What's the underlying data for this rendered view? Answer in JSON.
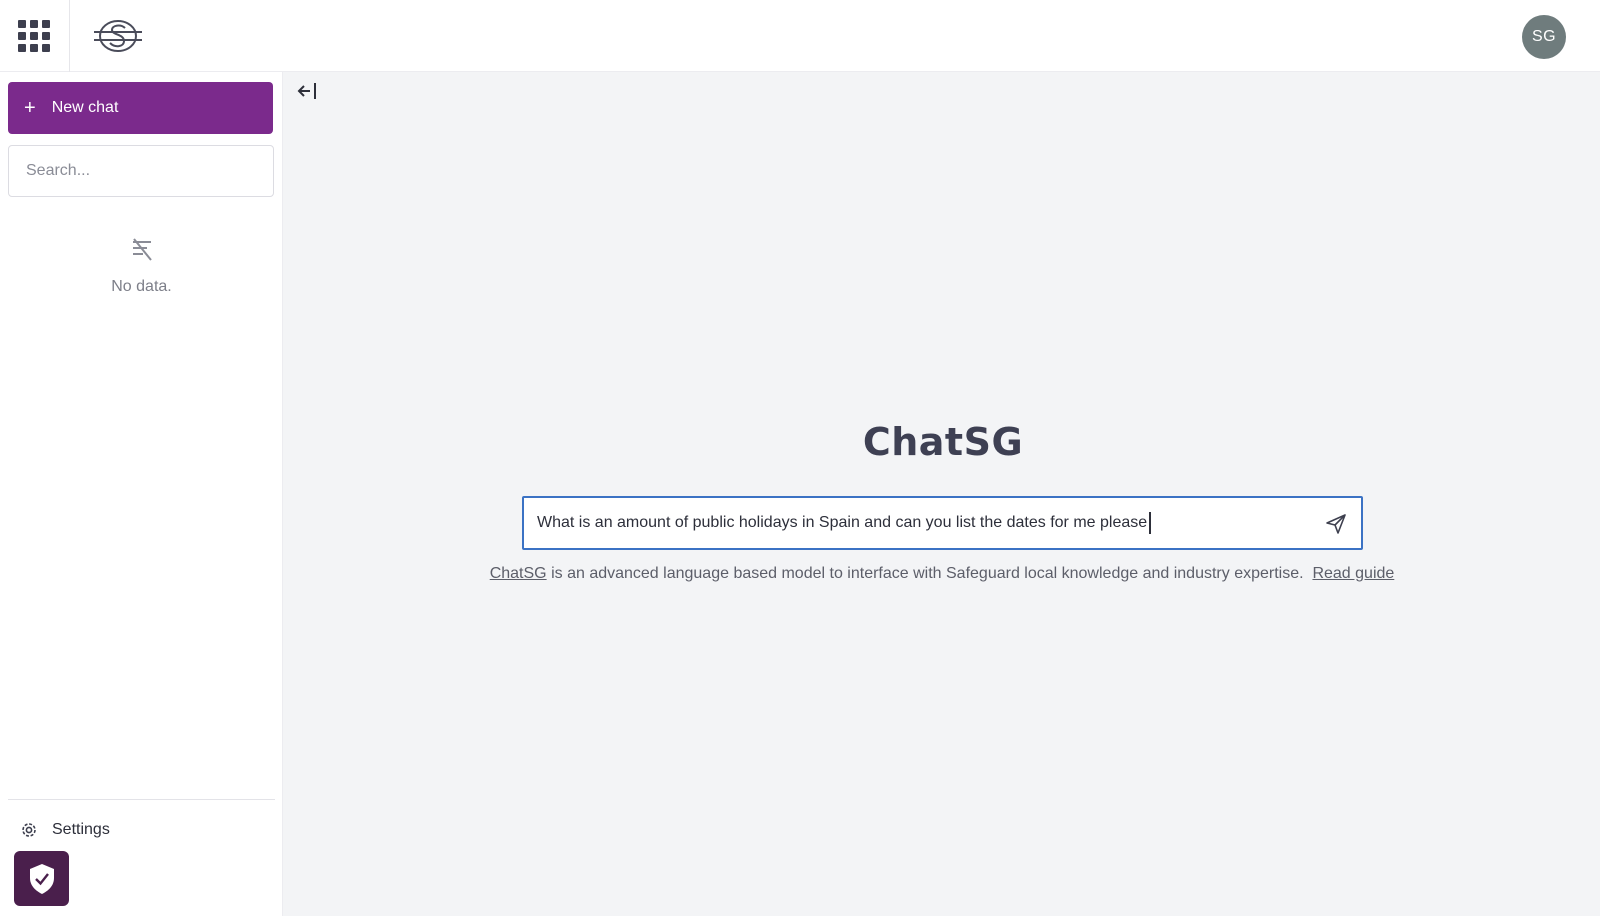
{
  "header": {
    "apps_icon": "grid-apps-icon",
    "logo": "safeguard-logo",
    "avatar_initials": "SG"
  },
  "sidebar": {
    "new_chat_label": "New chat",
    "new_chat_icon": "plus-icon",
    "search_placeholder": "Search...",
    "empty_state_icon": "no-data-icon",
    "empty_state_text": "No data.",
    "settings_label": "Settings",
    "settings_icon": "gear-icon",
    "shield_icon": "shield-check-icon"
  },
  "main": {
    "collapse_icon": "collapse-sidebar-icon",
    "title": "ChatSG",
    "prompt_value": "What is an amount of public holidays in Spain and can you list the dates for me please",
    "send_icon": "send-icon",
    "disclaimer_link": "ChatSG",
    "disclaimer_text": " is an advanced language based model to interface with Safeguard local knowledge and industry expertise.",
    "read_guide_label": "Read guide"
  },
  "colors": {
    "primary": "#7b2a8c",
    "shield_bg": "#4a1f4c",
    "input_border": "#3b72c4",
    "avatar_bg": "#6f7c7d",
    "page_bg": "#f3f4f6"
  }
}
